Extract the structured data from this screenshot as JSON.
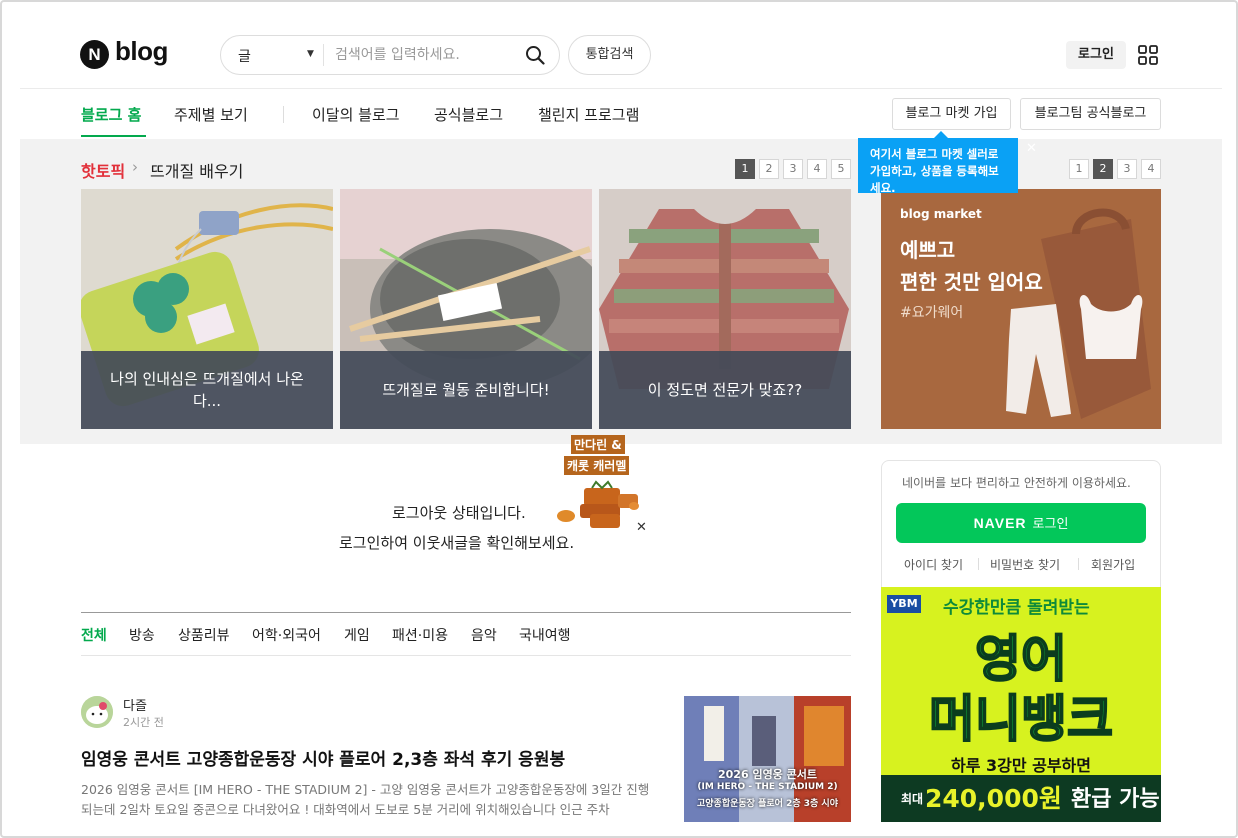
{
  "header": {
    "logo_letter": "N",
    "logo_word": "blog",
    "search_scope": "글",
    "search_placeholder": "검색어를 입력하세요.",
    "integrated_search": "통합검색",
    "login": "로그인"
  },
  "nav": {
    "left": [
      "블로그 홈",
      "주제별 보기"
    ],
    "right": [
      "이달의 블로그",
      "공식블로그",
      "챌린지 프로그램"
    ],
    "buttons": [
      "블로그 마켓 가입",
      "블로그팀 공식블로그"
    ]
  },
  "tooltip": {
    "text": "여기서 블로그 마켓 셀러로 가입하고, 상품을 등록해보세요."
  },
  "hot_topic": {
    "label": "핫토픽",
    "topic": "뜨개질 배우기",
    "pages": [
      "1",
      "2",
      "3",
      "4",
      "5"
    ],
    "active_page": "1",
    "cards": [
      {
        "caption": "나의 인내심은 뜨개질에서 나온다..."
      },
      {
        "caption": "뜨개질로 월동 준비합니다!"
      },
      {
        "caption": "이 정도면 전문가 맞죠??"
      }
    ]
  },
  "market_ad": {
    "pages": [
      "1",
      "2",
      "3",
      "4"
    ],
    "active_page": "2",
    "brand": "blog market",
    "line1": "예쁘고",
    "line2": "편한 것만 입어요",
    "tag": "#요가웨어"
  },
  "notice": {
    "line1": "로그아웃 상태입니다.",
    "line2": "로그인하여 이웃새글을 확인해보세요.",
    "promo_line1": "만다린 &",
    "promo_line2": "캐롯 캐러멜"
  },
  "login_panel": {
    "desc": "네이버를 보다 편리하고 안전하게 이용하세요.",
    "naver": "NAVER",
    "button": "로그인",
    "links": [
      "아이디 찾기",
      "비밀번호 찾기",
      "회원가입"
    ]
  },
  "english_ad": {
    "brand": "YBM",
    "headline_small": "수강한만큼 돌려받는",
    "headline1": "영어",
    "headline2": "머니뱅크",
    "sub": "하루 3강만 공부하면",
    "max": "최대",
    "amount": "240,000원",
    "refund": "환급 가능"
  },
  "categories": [
    "전체",
    "방송",
    "상품리뷰",
    "어학·외국어",
    "게임",
    "패션·미용",
    "음악",
    "국내여행"
  ],
  "post": {
    "author": "다즐",
    "time": "2시간 전",
    "title": "임영웅 콘서트 고양종합운동장 시야 플로어 2,3층 좌석 후기 응원봉",
    "body": "2026 임영웅 콘서트 [IM HERO - THE STADIUM 2] - 고양 임영웅 콘서트가 고양종합운동장에 3일간 진행되는데 2일차 토요일 중콘으로 다녀왔어요 ! 대화역에서 도보로 5분 거리에 위치해있습니다 인근 주차",
    "thumb_line1": "2026 임영웅 콘서트",
    "thumb_line2": "(IM HERO - THE STADIUM 2)",
    "thumb_line3": "고양종합운동장 플로어 2층 3층 시야"
  },
  "colors": {
    "brand_green": "#03a94d",
    "naver_green": "#03c75a",
    "tooltip_blue": "#0aa1f5",
    "hot_red": "#e2303a"
  }
}
